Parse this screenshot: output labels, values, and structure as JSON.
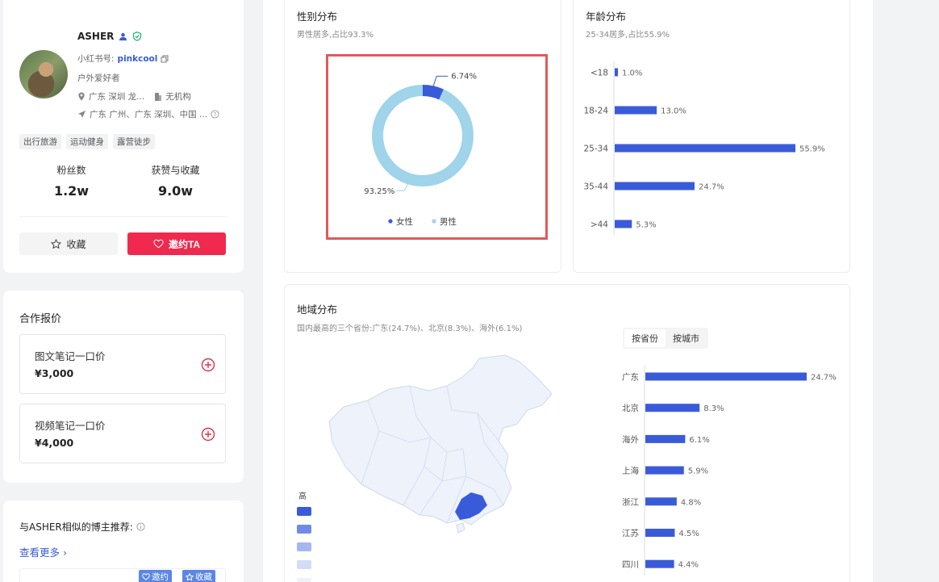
{
  "profile": {
    "name": "ASHER",
    "xhs_label": "小红书号:",
    "xhs_id": "pinkcool",
    "bio": "户外爱好者",
    "location": "广东 深圳 龙...",
    "org": "无机构",
    "travel": "广东 广州、广东 深圳、中国 ...",
    "tags": [
      "出行旅游",
      "运动健身",
      "露营徒步"
    ],
    "fans_label": "粉丝数",
    "fans_value": "1.2w",
    "likes_label": "获赞与收藏",
    "likes_value": "9.0w",
    "collect_label": "收藏",
    "invite_label": "邀约TA"
  },
  "pricing": {
    "title": "合作报价",
    "items": [
      {
        "label": "图文笔记一口价",
        "price": "¥3,000"
      },
      {
        "label": "视频笔记一口价",
        "price": "¥4,000"
      }
    ]
  },
  "similar": {
    "title": "与ASHER相似的博主推荐:",
    "more": "查看更多",
    "invite": "邀约",
    "collect": "收藏"
  },
  "gender": {
    "title": "性别分布",
    "subtitle": "男性居多,占比93.3%",
    "legend": [
      "女性",
      "男性"
    ],
    "colors": {
      "female": "#3a5bd9",
      "male": "#9fd4ea"
    }
  },
  "age": {
    "title": "年龄分布",
    "subtitle": "25-34居多,占比55.9%",
    "color": "#3a5bd9"
  },
  "region": {
    "title": "地域分布",
    "subtitle": "国内最高的三个省份:广东(24.7%)、北京(8.3%)、海外(6.1%)",
    "tab_province": "按省份",
    "tab_city": "按城市",
    "scale_high": "高",
    "map_colors": [
      "#3a5bd9",
      "#6f8ae8",
      "#a5b6f0",
      "#d3dcf7",
      "#eef2fb"
    ]
  },
  "chart_data": [
    {
      "type": "pie",
      "categories": [
        "女性",
        "男性"
      ],
      "values": [
        6.74,
        93.25
      ],
      "data_labels": [
        "6.74%",
        "93.25%"
      ]
    },
    {
      "type": "bar",
      "orientation": "horizontal",
      "categories": [
        "<18",
        "18-24",
        "25-34",
        "35-44",
        ">44"
      ],
      "values": [
        1.0,
        13.0,
        55.9,
        24.7,
        5.3
      ],
      "data_labels": [
        "1.0%",
        "13.0%",
        "55.9%",
        "24.7%",
        "5.3%"
      ]
    },
    {
      "type": "bar",
      "orientation": "horizontal",
      "categories": [
        "广东",
        "北京",
        "海外",
        "上海",
        "浙江",
        "江苏",
        "四川"
      ],
      "values": [
        24.7,
        8.3,
        6.1,
        5.9,
        4.8,
        4.5,
        4.4
      ],
      "data_labels": [
        "24.7%",
        "8.3%",
        "6.1%",
        "5.9%",
        "4.8%",
        "4.5%",
        "4.4%"
      ]
    }
  ]
}
